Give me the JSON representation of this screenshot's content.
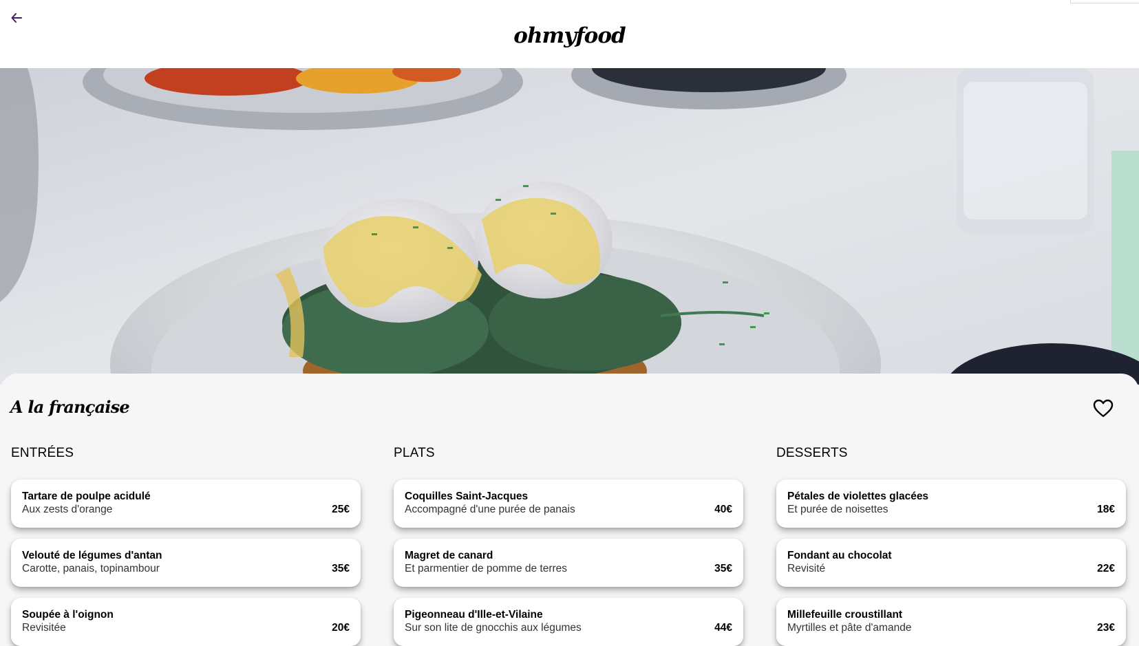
{
  "header": {
    "logo": "ohmyfood",
    "back_icon": "arrow-left-icon"
  },
  "hero": {
    "image": "plate-of-eggs-benedict-on-spinach"
  },
  "restaurant": {
    "title": "A la française",
    "favorite_icon": "heart-outline-icon"
  },
  "colors": {
    "accent": "#4b1a5c",
    "panel_bg": "#f6f6f6",
    "card_bg": "#ffffff"
  },
  "menu": {
    "columns": [
      {
        "heading": "Entrées",
        "items": [
          {
            "name": "Tartare de poulpe acidulé",
            "description": "Aux zests d'orange",
            "price": "25€"
          },
          {
            "name": "Velouté de légumes d'antan",
            "description": "Carotte, panais, topinambour",
            "price": "35€"
          },
          {
            "name": "Soupée à l'oignon",
            "description": "Revisitée",
            "price": "20€"
          }
        ]
      },
      {
        "heading": "Plats",
        "items": [
          {
            "name": "Coquilles Saint-Jacques",
            "description": "Accompagné d'une purée de panais",
            "price": "40€"
          },
          {
            "name": "Magret de canard",
            "description": "Et parmentier de pomme de terres",
            "price": "35€"
          },
          {
            "name": "Pigeonneau d'Ille-et-Vilaine",
            "description": "Sur son lite de gnocchis aux légumes",
            "price": "44€"
          }
        ]
      },
      {
        "heading": "Desserts",
        "items": [
          {
            "name": "Pétales de violettes glacées",
            "description": "Et purée de noisettes",
            "price": "18€"
          },
          {
            "name": "Fondant au chocolat",
            "description": "Revisité",
            "price": "22€"
          },
          {
            "name": "Millefeuille croustillant",
            "description": "Myrtilles et pâte d'amande",
            "price": "23€"
          }
        ]
      }
    ]
  }
}
